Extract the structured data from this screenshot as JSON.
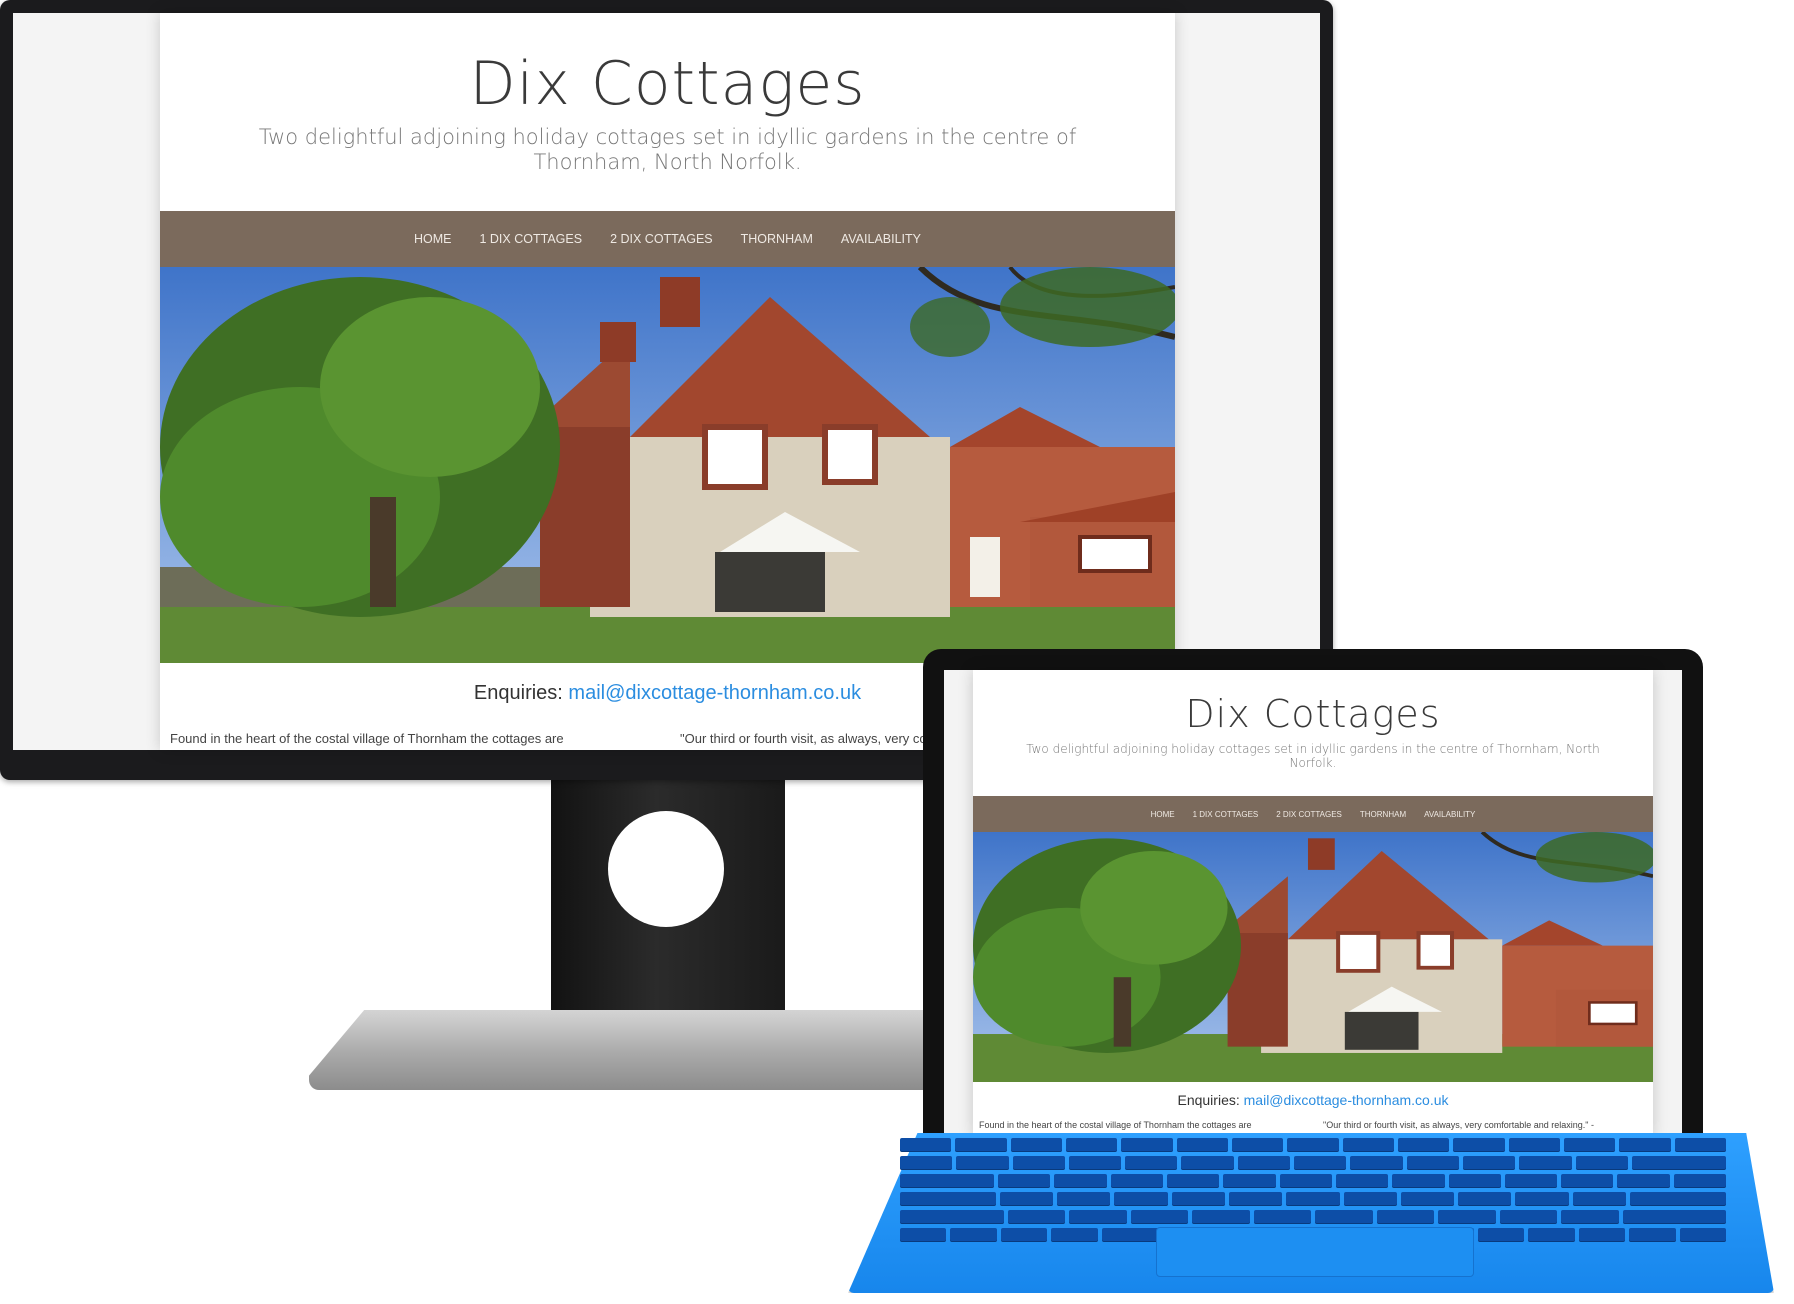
{
  "site": {
    "title": "Dix Cottages",
    "tagline": "Two delightful adjoining holiday cottages set in idyllic gardens in the centre of Thornham, North Norfolk.",
    "nav": [
      "HOME",
      "1 DIX COTTAGES",
      "2 DIX COTTAGES",
      "THORNHAM",
      "AVAILABILITY"
    ],
    "enquiries_label": "Enquiries:",
    "enquiries_email": "mail@dixcottage-thornham.co.uk",
    "body_left": "Found in the heart of the costal village of Thornham the cottages are",
    "body_right": "\"Our third or fourth visit, as always, very comfortable and relaxing.\" -"
  },
  "colors": {
    "nav_bg": "#7b6a5c",
    "link": "#2b8de0",
    "keyboard": "#1786ec"
  },
  "icons": {
    "monitor": "monitor-icon",
    "tablet": "tablet-icon",
    "keyboard": "keyboard-icon"
  }
}
